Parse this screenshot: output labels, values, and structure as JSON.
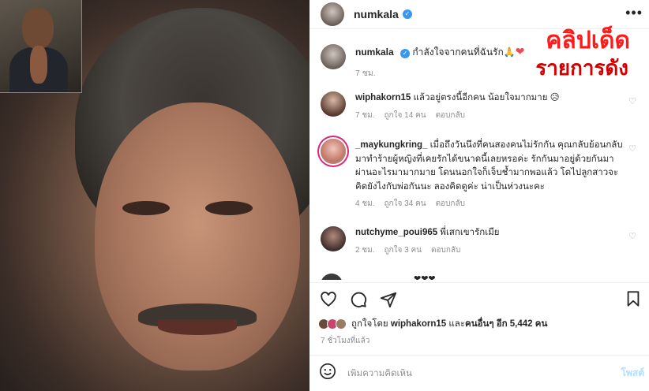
{
  "header": {
    "username": "numkala",
    "verified_icon": "verified-badge-icon",
    "more_icon": "more-options-icon"
  },
  "overlay": {
    "line1": "คลิปเด็ด",
    "line2": "รายการดัง"
  },
  "caption": {
    "username": "numkala",
    "text": "กำลังใจจากคนที่ฉันรัก🙏",
    "heart": "❤",
    "time": "7 ชม."
  },
  "comments": [
    {
      "username": "wiphakorn15",
      "text": "แล้วอยู่ตรงนี้อีกคน น้อยใจมากมาย 😥",
      "time": "7 ชม.",
      "likes": "ถูกใจ 14 คน",
      "reply": "ตอบกลับ"
    },
    {
      "username": "_maykungkring_",
      "text": "เมื่อถึงวันนึงที่คนสองคนไม่รักกัน คุณกลับย้อนกลับมาทำร้ายผู้หญิงที่เคยรักได้ขนาดนี้เลยหรอค่ะ รักกันมาอยู่ด้วยกันมาผ่านอะไรมามากมาย โดนนอกใจก็เจ็บช้ำมากพอแล้ว โตไปลูกสาวจะคิดยังไงกับพ่อกันนะ ลองคิดดูค่ะ น่าเป็นห่วงนะคะ",
      "time": "4 ชม.",
      "likes": "ถูกใจ 34 คน",
      "reply": "ตอบกลับ"
    },
    {
      "username": "nutchyme_poui965",
      "text": "พี่เสกเขารักเมีย",
      "time": "2 ชม.",
      "likes": "ถูกใจ 3 คน",
      "reply": "ตอบกลับ"
    }
  ],
  "partial_comment": {
    "text": "❤❤❤"
  },
  "actions": {
    "like_icon": "heart-outline-icon",
    "comment_icon": "comment-icon",
    "share_icon": "share-icon",
    "save_icon": "bookmark-icon"
  },
  "liked_by": {
    "prefix": "ถูกใจโดย",
    "user": "wiphakorn15",
    "middle": "และ",
    "others": "คนอื่นๆ อีก 5,442 คน"
  },
  "posted_ago": "7 ชั่วโมงที่แล้ว",
  "composer": {
    "placeholder": "เพิ่มความคิดเห็น",
    "post_label": "โพสต์",
    "emoji_icon": "emoji-icon"
  },
  "colors": {
    "overlay_red": "#ff1a1a",
    "verified_blue": "#3897f0",
    "meta_gray": "#8e8e8e"
  }
}
